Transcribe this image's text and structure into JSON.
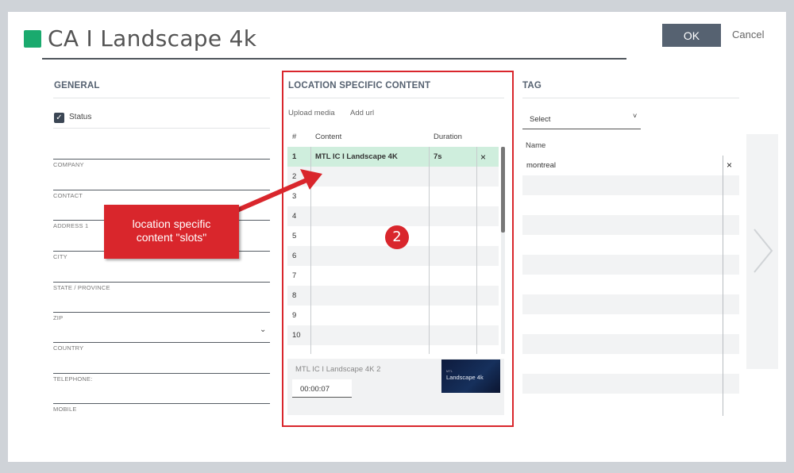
{
  "dialog": {
    "title": "CA I Landscape 4k",
    "title_color": "#1aaa6e",
    "ok_label": "OK",
    "cancel_label": "Cancel"
  },
  "general": {
    "heading": "GENERAL",
    "status_label": "Status",
    "status_checked": true,
    "fields": [
      "COMPANY",
      "CONTACT",
      "ADDRESS 1",
      "CITY",
      "STATE / PROVINCE",
      "ZIP",
      "COUNTRY",
      "TELEPHONE:",
      "MOBILE"
    ]
  },
  "location_content": {
    "heading": "LOCATION SPECIFIC CONTENT",
    "upload_label": "Upload media",
    "add_url_label": "Add url",
    "columns": [
      "#",
      "Content",
      "Duration"
    ],
    "rows": [
      {
        "num": "1",
        "content": "MTL IC I Landscape 4K",
        "duration": "7s",
        "selected": true
      },
      {
        "num": "2",
        "content": "",
        "duration": ""
      },
      {
        "num": "3",
        "content": "",
        "duration": ""
      },
      {
        "num": "4",
        "content": "",
        "duration": ""
      },
      {
        "num": "5",
        "content": "",
        "duration": ""
      },
      {
        "num": "6",
        "content": "",
        "duration": ""
      },
      {
        "num": "7",
        "content": "",
        "duration": ""
      },
      {
        "num": "8",
        "content": "",
        "duration": ""
      },
      {
        "num": "9",
        "content": "",
        "duration": ""
      },
      {
        "num": "10",
        "content": "",
        "duration": ""
      }
    ],
    "remove_icon": "×",
    "detail": {
      "name": "MTL IC I Landscape 4K 2",
      "time": "00:00:07",
      "thumb_small": "MTL",
      "thumb_title": "Landscape 4k"
    }
  },
  "tag": {
    "heading": "TAG",
    "select_value": "Select",
    "caret": "˅",
    "column_name": "Name",
    "items": [
      "montreal"
    ],
    "remove_icon": "×"
  },
  "annotation": {
    "callout_line1": "location specific",
    "callout_line2": "content \"slots\"",
    "badge": "2",
    "accent": "#d9262c"
  }
}
